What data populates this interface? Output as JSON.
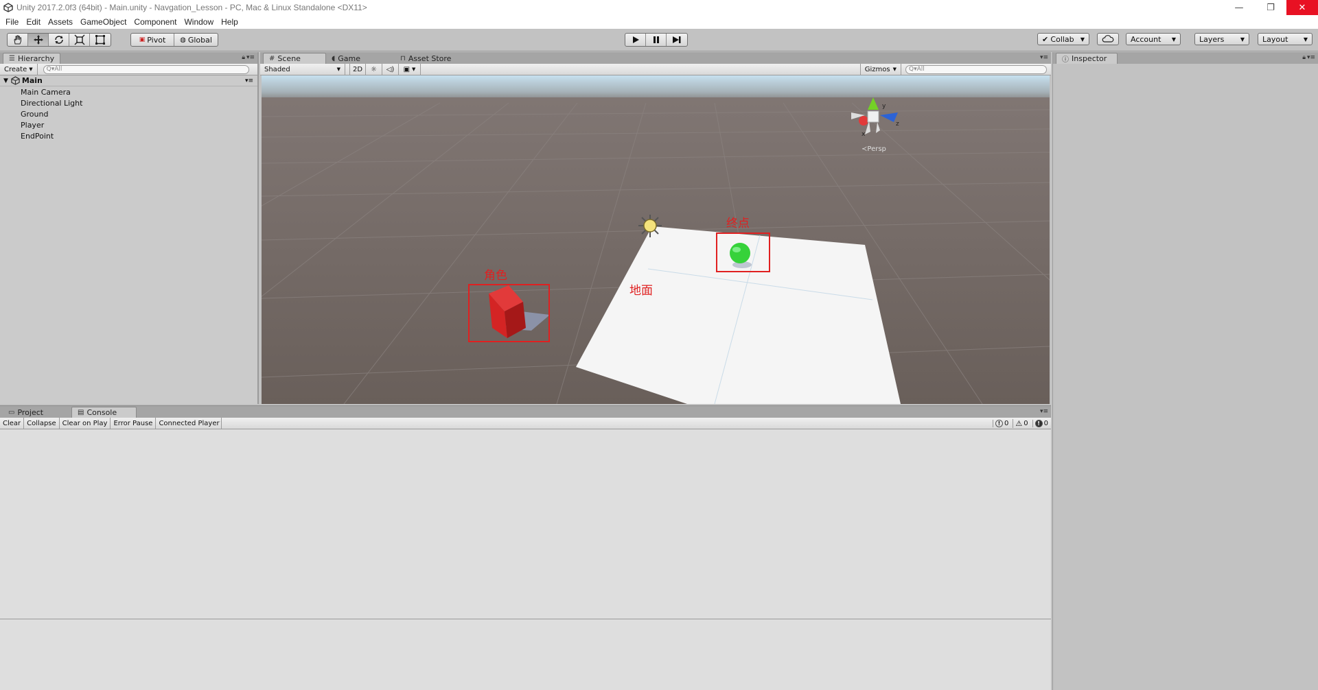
{
  "window": {
    "title": "Unity 2017.2.0f3 (64bit) - Main.unity - Navgation_Lesson - PC, Mac & Linux Standalone <DX11>",
    "minimize": "—",
    "restore": "❐",
    "close": "✕"
  },
  "menu": [
    "File",
    "Edit",
    "Assets",
    "GameObject",
    "Component",
    "Window",
    "Help"
  ],
  "toolbar": {
    "pivot": "Pivot",
    "global": "Global",
    "collab": "Collab",
    "account": "Account",
    "layers": "Layers",
    "layout": "Layout"
  },
  "hierarchy": {
    "tab": "Hierarchy",
    "create": "Create",
    "search_placeholder": "Q▾All",
    "root": "Main",
    "items": [
      "Main Camera",
      "Directional Light",
      "Ground",
      "Player",
      "EndPoint"
    ]
  },
  "scene": {
    "tabs": [
      "Scene",
      "Game",
      "Asset Store"
    ],
    "shading": "Shaded",
    "mode2d": "2D",
    "gizmos": "Gizmos",
    "search_placeholder": "Q▾All",
    "persp": "Persp",
    "gizmo_axes": {
      "y": "y",
      "z": "z",
      "x": "x"
    },
    "annotations": {
      "player": "角色",
      "ground": "地面",
      "endpoint": "终点"
    },
    "colors": {
      "sky_top": "#c7e1ef",
      "ground": "#6e6460",
      "cube": "#e52a2a",
      "sphere": "#36d23a",
      "annotation": "#e02020"
    }
  },
  "inspector": {
    "tab": "Inspector"
  },
  "console": {
    "tabs": [
      "Project",
      "Console"
    ],
    "buttons": [
      "Clear",
      "Collapse",
      "Clear on Play",
      "Error Pause",
      "Connected Player"
    ],
    "counts": {
      "info": "0",
      "warn": "0",
      "error": "0"
    }
  }
}
